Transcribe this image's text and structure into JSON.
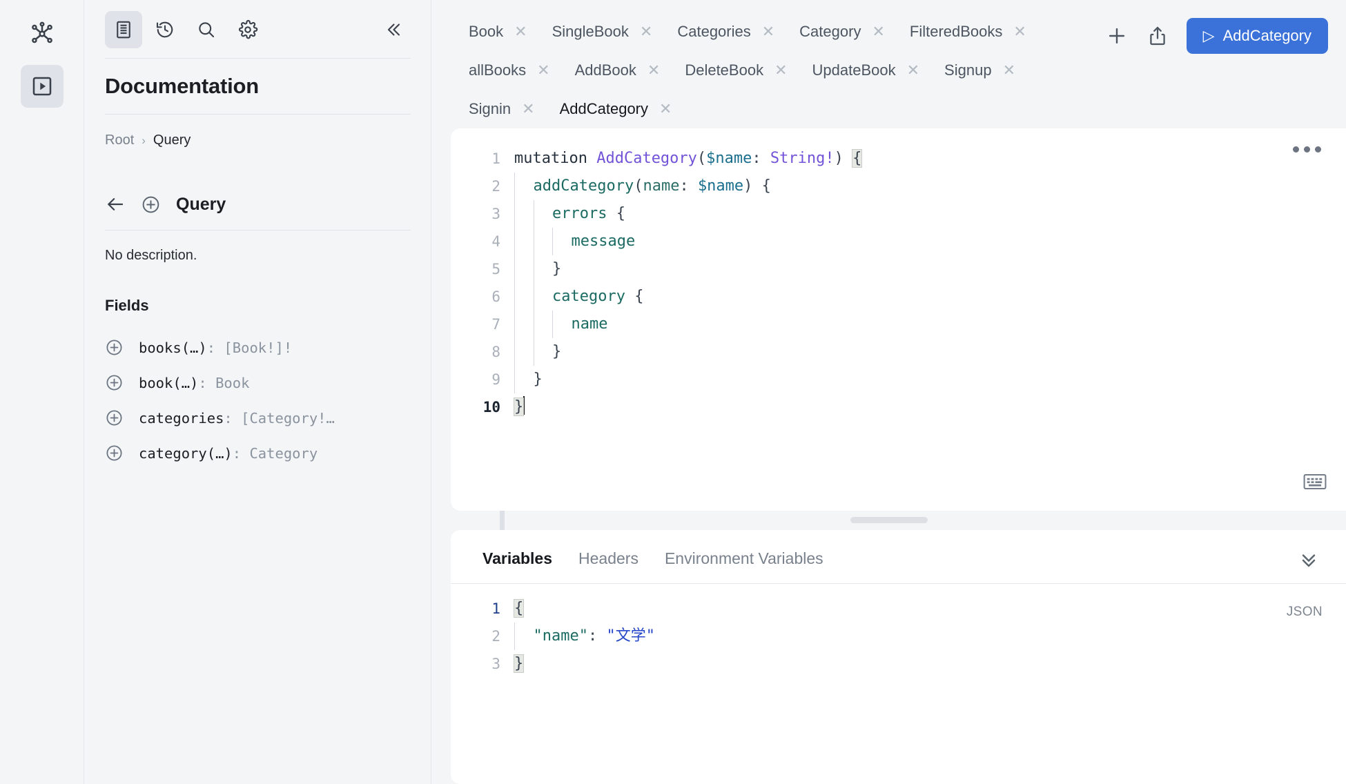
{
  "rail": {
    "graph_icon": "graph-nodes-icon",
    "explorer_icon": "play-box-icon"
  },
  "docs": {
    "toolbar": [
      {
        "name": "documentation-icon",
        "label": "Documentation",
        "active": true
      },
      {
        "name": "history-icon",
        "label": "History",
        "active": false
      },
      {
        "name": "search-icon",
        "label": "Search",
        "active": false
      },
      {
        "name": "settings-gear-icon",
        "label": "Settings",
        "active": false
      }
    ],
    "collapse_icon": "chevron-double-left-icon",
    "title": "Documentation",
    "breadcrumb": {
      "root": "Root",
      "separator": "›",
      "current": "Query"
    },
    "type_header": {
      "back_icon": "arrow-left-icon",
      "add_icon": "plus-circle-icon",
      "name": "Query"
    },
    "description": "No description.",
    "fields_heading": "Fields",
    "fields": [
      {
        "name": "books(…)",
        "type": ": [Book!]!"
      },
      {
        "name": "book(…)",
        "type": ": Book"
      },
      {
        "name": "categories",
        "type": ": [Category!…"
      },
      {
        "name": "category(…)",
        "type": ": Category"
      }
    ]
  },
  "tabs": [
    {
      "label": "Book",
      "active": false
    },
    {
      "label": "SingleBook",
      "active": false
    },
    {
      "label": "Categories",
      "active": false
    },
    {
      "label": "Category",
      "active": false
    },
    {
      "label": "FilteredBooks",
      "active": false
    },
    {
      "label": "allBooks",
      "active": false
    },
    {
      "label": "AddBook",
      "active": false
    },
    {
      "label": "DeleteBook",
      "active": false
    },
    {
      "label": "UpdateBook",
      "active": false
    },
    {
      "label": "Signup",
      "active": false
    },
    {
      "label": "Signin",
      "active": false
    },
    {
      "label": "AddCategory",
      "active": true
    }
  ],
  "tab_close_glyph": "✕",
  "toolbar": {
    "add_tab_icon": "plus-icon",
    "share_icon": "share-upload-icon",
    "run_label": "AddCategory",
    "run_play_glyph": "▷",
    "run_color": "#3b72d9"
  },
  "editor": {
    "more_icon": "three-dots-menu-icon",
    "keyboard_icon": "keyboard-shortcuts-icon",
    "line_numbers": [
      "1",
      "2",
      "3",
      "4",
      "5",
      "6",
      "7",
      "8",
      "9",
      "10"
    ],
    "active_line": 10,
    "code": [
      "mutation AddCategory($name: String!) {",
      "  addCategory(name: $name) {",
      "    errors {",
      "      message",
      "    }",
      "    category {",
      "      name",
      "    }",
      "  }",
      "}"
    ],
    "tokens": {
      "keyword": "mutation",
      "operation_name": "AddCategory",
      "variable": "$name",
      "variable_type": "String!",
      "field_add_category": "addCategory",
      "arg_name": "name",
      "field_errors": "errors",
      "field_message": "message",
      "field_category": "category",
      "field_name": "name"
    },
    "syntax_colors": {
      "keyword": "#27313d",
      "operation_name": "#7152d8",
      "variable": "#1a6e8e",
      "type": "#7152d8",
      "field": "#1b6b63",
      "punctuation": "#3a4450"
    }
  },
  "variables_panel": {
    "tabs": [
      {
        "label": "Variables",
        "active": true
      },
      {
        "label": "Headers",
        "active": false
      },
      {
        "label": "Environment Variables",
        "active": false
      }
    ],
    "collapse_icon": "chevron-double-down-icon",
    "format_label": "JSON",
    "line_numbers": [
      "1",
      "2",
      "3"
    ],
    "content": [
      "{",
      "  \"name\": \"文学\"",
      "}"
    ],
    "json_key": "\"name\"",
    "json_value": "\"文学\"",
    "colors": {
      "key": "#1b6b63",
      "value": "#2546c9"
    }
  }
}
